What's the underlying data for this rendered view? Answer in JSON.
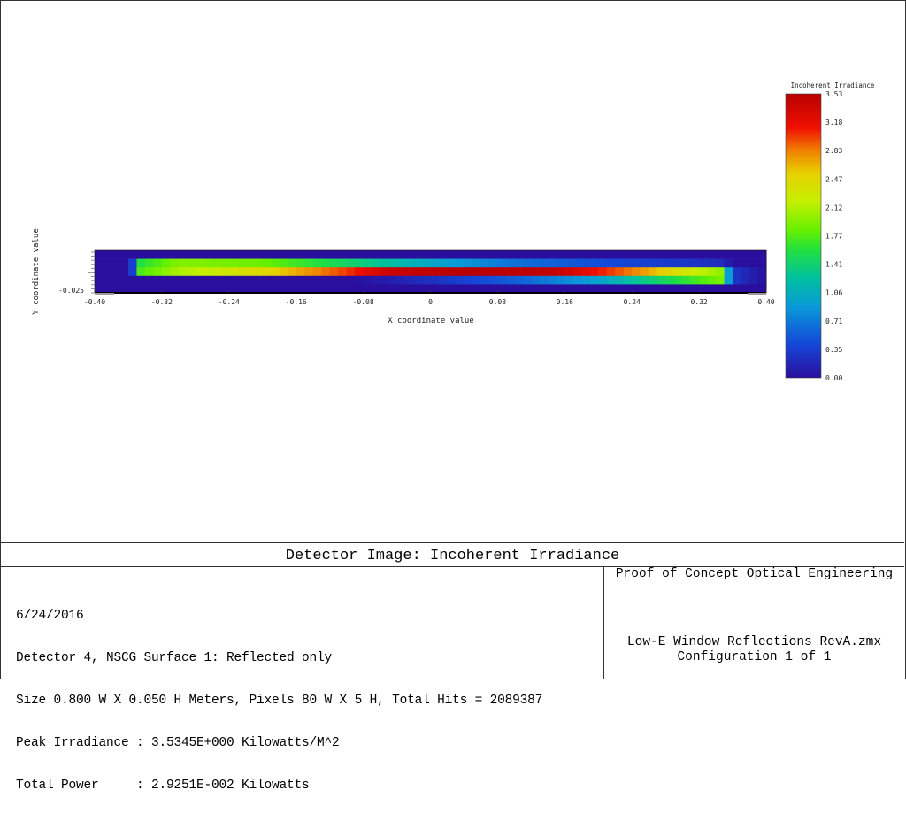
{
  "chart_data": {
    "type": "heatmap",
    "title": "Detector Image: Incoherent Irradiance",
    "xlabel": "X coordinate value",
    "ylabel": "Y coordinate value",
    "xlim": [
      -0.4,
      0.4
    ],
    "ylim": [
      -0.025,
      0.025
    ],
    "x_ticks": [
      "-0.40",
      "-0.32",
      "-0.24",
      "-0.16",
      "-0.08",
      "0",
      "0.08",
      "0.16",
      "0.24",
      "0.32",
      "0.40"
    ],
    "y_ticks": [
      "-0.025"
    ],
    "colorbar": {
      "title": "Incoherent Irradiance",
      "min": 0.0,
      "max": 3.53,
      "ticks": [
        "3.53",
        "3.18",
        "2.83",
        "2.47",
        "2.12",
        "1.77",
        "1.41",
        "1.06",
        "0.71",
        "0.35",
        "0.00"
      ],
      "colormap": "rainbow"
    },
    "grid": {
      "columns": 80,
      "rows": 5,
      "note": "values in Kilowatts/M^2, rows top to bottom, columns left (-0.40) to right (0.40)",
      "row_profiles": [
        {
          "row": 0,
          "x": [
            -0.4,
            0.4
          ],
          "values": [
            0,
            0
          ]
        },
        {
          "row": 1,
          "x": [
            -0.4,
            -0.36,
            -0.355,
            -0.35,
            -0.3,
            -0.2,
            -0.1,
            0.0,
            0.1,
            0.2,
            0.3,
            0.35,
            0.36,
            0.4
          ],
          "values": [
            0,
            0,
            0.35,
            1.55,
            1.95,
            1.85,
            1.45,
            1.0,
            0.65,
            0.45,
            0.3,
            0.2,
            0,
            0
          ]
        },
        {
          "row": 2,
          "x": [
            -0.4,
            -0.36,
            -0.355,
            -0.35,
            -0.3,
            -0.2,
            -0.1,
            -0.05,
            0.05,
            0.15,
            0.2,
            0.25,
            0.3,
            0.345,
            0.35,
            0.36,
            0.4
          ],
          "values": [
            0,
            0,
            0.35,
            1.7,
            2.1,
            2.45,
            3.0,
            3.4,
            3.53,
            3.45,
            3.1,
            2.75,
            2.35,
            2.0,
            1.5,
            0.3,
            0
          ]
        },
        {
          "row": 3,
          "x": [
            -0.4,
            -0.1,
            -0.05,
            0.0,
            0.1,
            0.2,
            0.25,
            0.3,
            0.345,
            0.35,
            0.36,
            0.4
          ],
          "values": [
            0,
            0,
            0.1,
            0.25,
            0.55,
            0.95,
            1.3,
            1.6,
            1.9,
            1.5,
            0.3,
            0
          ]
        },
        {
          "row": 4,
          "x": [
            -0.4,
            0.4
          ],
          "values": [
            0,
            0
          ]
        }
      ]
    }
  },
  "footer": {
    "title": "Detector Image: Incoherent Irradiance",
    "info_lines": [
      "6/24/2016",
      "Detector 4, NSCG Surface 1: Reflected only",
      "Size 0.800 W X 0.050 H Meters, Pixels 80 W X 5 H, Total Hits = 2089387",
      "Peak Irradiance : 3.5345E+000 Kilowatts/M^2",
      "Total Power     : 2.9251E-002 Kilowatts"
    ],
    "company": "Proof of Concept Optical Engineering",
    "file_name": "Low-E Window Reflections RevA.zmx",
    "configuration": "Configuration 1 of 1"
  }
}
